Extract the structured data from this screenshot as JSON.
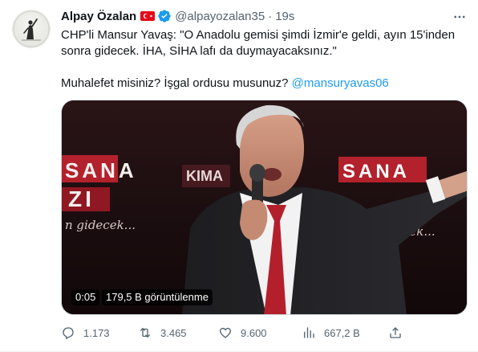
{
  "author": {
    "name": "Alpay Özalan",
    "handle": "@alpayozalan35",
    "separator": "·",
    "time": "19s"
  },
  "tweet": {
    "line1": "CHP'li Mansur Yavaş: \"O Anadolu gemisi şimdi İzmir'e geldi, ayın 15'inden",
    "line2": "sonra gidecek. İHA, SİHA lafı da duymayacaksınız.\"",
    "line3": "Muhalefet misiniz? İşgal ordusu musunuz?",
    "mention": "@mansuryavas06"
  },
  "video": {
    "timestamp": "0:05",
    "views": "179,5 B görüntülenme",
    "banner_left": [
      "SANA",
      "ZI"
    ],
    "banner_center": "KIMA",
    "banner_right": "SANA",
    "script_left": "n gidecek...",
    "script_right": "un gidecek..."
  },
  "actions": {
    "replies": "1.173",
    "retweets": "3.465",
    "likes": "9.600",
    "views": "667,2 B"
  },
  "colors": {
    "accent": "#1d9bf0",
    "muted": "#536471",
    "flag": "#e30a17"
  },
  "icons": [
    "avatar",
    "turkey-flag-icon",
    "verified-badge-icon",
    "more-icon",
    "reply-icon",
    "retweet-icon",
    "like-icon",
    "views-icon",
    "share-icon"
  ]
}
